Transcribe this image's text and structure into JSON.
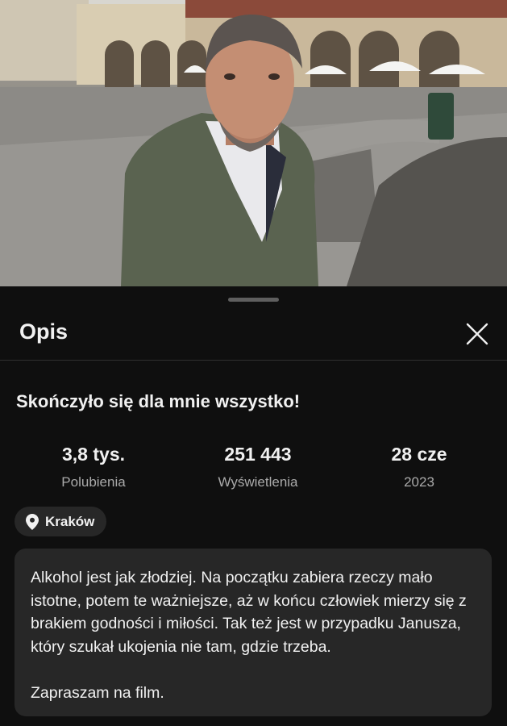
{
  "video": {
    "thumbnail": "Man in green jacket speaking on a rainy town square with arcaded buildings and white umbrellas"
  },
  "sheet": {
    "title": "Opis",
    "close_icon": "close-icon"
  },
  "video_title": "Skończyło się dla mnie wszystko!",
  "stats": [
    {
      "value": "3,8 tys.",
      "label": "Polubienia"
    },
    {
      "value": "251 443",
      "label": "Wyświetlenia"
    },
    {
      "value": "28 cze",
      "label": "2023"
    }
  ],
  "location": {
    "icon": "location-pin-icon",
    "label": "Kraków"
  },
  "description": {
    "paragraph1": "Alkohol jest jak złodziej. Na początku zabiera rzeczy mało istotne, potem te ważniejsze, aż w końcu człowiek mierzy się z brakiem godności i miłości. Tak też jest w przypadku Janusza, który szukał ukojenia nie tam, gdzie trzeba.",
    "paragraph2": "Zapraszam na film."
  },
  "colors": {
    "background": "#0f0f0f",
    "surface": "#272727",
    "text_primary": "#f1f1f1",
    "text_secondary": "#aaaaaa",
    "divider": "#303030"
  }
}
